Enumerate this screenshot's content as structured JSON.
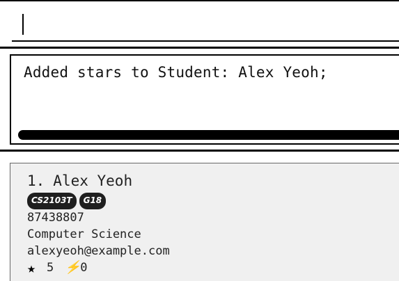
{
  "command_box": {
    "value": "",
    "placeholder": ""
  },
  "result_display": {
    "message": "Added stars to Student: Alex Yeoh;"
  },
  "person_list": {
    "items": [
      {
        "index": "1.",
        "name": "Alex Yeoh",
        "tags": [
          "CS2103T",
          "G18"
        ],
        "phone": "87438807",
        "major": "Computer Science",
        "email": "alexyeoh@example.com",
        "stars": "5",
        "bolts": "0"
      }
    ]
  },
  "icons": {
    "star": "star-icon",
    "bolt": "lightning-bolt-icon"
  },
  "colors": {
    "tag_background": "#1f1f1f",
    "list_background": "#f0f0f0"
  }
}
